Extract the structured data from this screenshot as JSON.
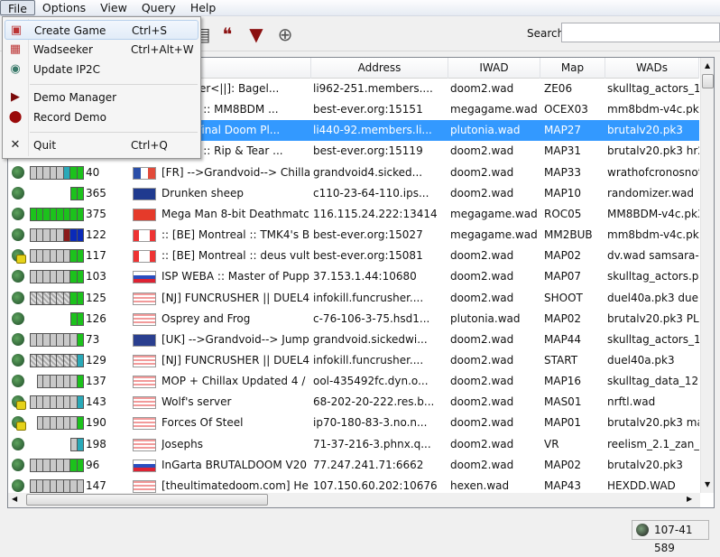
{
  "menubar": [
    "File",
    "Options",
    "View",
    "Query",
    "Help"
  ],
  "file_menu": [
    {
      "label": "Create Game",
      "shortcut": "Ctrl+S",
      "icon": "create-game-icon"
    },
    {
      "label": "Wadseeker",
      "shortcut": "Ctrl+Alt+W",
      "icon": "wadseeker-icon"
    },
    {
      "label": "Update IP2C",
      "shortcut": "",
      "icon": "globe-icon"
    },
    {
      "label": "Demo Manager",
      "shortcut": "",
      "icon": "play-icon"
    },
    {
      "label": "Record Demo",
      "shortcut": "",
      "icon": "record-icon"
    },
    {
      "label": "Quit",
      "shortcut": "Ctrl+Q",
      "icon": "close-icon"
    }
  ],
  "toolbar": {
    "icons": [
      "document-icon",
      "chat-icon",
      "filter-icon",
      "add-monitor-icon"
    ],
    "search_label": "Search:",
    "search_value": ""
  },
  "columns": [
    "rver Name",
    "Address",
    "IWAD",
    "Map",
    "WADs"
  ],
  "rows": [
    {
      "players": "",
      "ping": "",
      "flag": "",
      "name": "Painkiller<||]: Bagel...",
      "address": "li962-251.members....",
      "iwad": "doom2.wad",
      "map": "ZE06",
      "wads": "skulltag_actors_1-1",
      "lock": false
    },
    {
      "players": "",
      "ping": "",
      "flag": "",
      "name": "ontreal :: MM8BDM ...",
      "address": "best-ever.org:15151",
      "iwad": "megagame.wad",
      "map": "OCEX03",
      "wads": "mm8bdm-v4c.pk3",
      "lock": false
    },
    {
      "players": "",
      "ping": "",
      "flag": "",
      "name": "oom - Final Doom Pl...",
      "address": "li440-92.members.li...",
      "iwad": "plutonia.wad",
      "map": "MAP27",
      "wads": "brutalv20.pk3",
      "lock": false,
      "selected": true
    },
    {
      "players": "",
      "ping": "",
      "flag": "",
      "name": "ontreal :: Rip & Tear ...",
      "address": "best-ever.org:15119",
      "iwad": "doom2.wad",
      "map": "MAP31",
      "wads": "brutalv20.pk3 hr2fi",
      "lock": false
    },
    {
      "players": "gggggcGG",
      "ping": "40",
      "flag": "FR",
      "name": "[FR] -->Grandvoid--> Chilla...",
      "address": "grandvoid4.sicked...",
      "iwad": "doom2.wad",
      "map": "MAP33",
      "wads": "wrathofcronosnoth",
      "lock": false
    },
    {
      "players": "GG",
      "ping": "365",
      "flag": "AU",
      "name": "Drunken sheep",
      "address": "c110-23-64-110.ips...",
      "iwad": "doom2.wad",
      "map": "MAP10",
      "wads": "randomizer.wad",
      "lock": false
    },
    {
      "players": "GGGGGGGG",
      "ping": "375",
      "flag": "CN",
      "name": "Mega Man 8-bit Deathmatc...",
      "address": "116.115.24.222:13414",
      "iwad": "megagame.wad",
      "map": "ROC05",
      "wads": "MM8BDM-v4c.pk3",
      "lock": false
    },
    {
      "players": "gggggrBB",
      "ping": "122",
      "flag": "CA",
      "name": ":: [BE] Montreal :: TMK4's Bo...",
      "address": "best-ever.org:15027",
      "iwad": "megagame.wad",
      "map": "MM2BUB",
      "wads": "mm8bdm-v4c.pk3",
      "lock": false
    },
    {
      "players": "ggggggGG",
      "ping": "117",
      "flag": "CA",
      "name": ":: [BE] Montreal :: deus vult s...",
      "address": "best-ever.org:15081",
      "iwad": "doom2.wad",
      "map": "MAP02",
      "wads": "dv.wad samsara-v0",
      "lock": true
    },
    {
      "players": "ggggggGG",
      "ping": "103",
      "flag": "RU",
      "name": "ISP WEBA :: Master of Puppets",
      "address": "37.153.1.44:10680",
      "iwad": "doom2.wad",
      "map": "MAP07",
      "wads": "skulltag_actors.pk3",
      "lock": false
    },
    {
      "players": "xxxxxxGG",
      "ping": "125",
      "flag": "US",
      "name": "[NJ] FUNCRUSHER || DUEL40...",
      "address": "infokill.funcrusher....",
      "iwad": "doom2.wad",
      "map": "SHOOT",
      "wads": "duel40a.pk3 duelel",
      "lock": false
    },
    {
      "players": "GG",
      "ping": "126",
      "flag": "US",
      "name": "Osprey and Frog",
      "address": "c-76-106-3-75.hsd1...",
      "iwad": "plutonia.wad",
      "map": "MAP02",
      "wads": "brutalv20.pk3 PL2..",
      "lock": false
    },
    {
      "players": "gggggggG",
      "ping": "73",
      "flag": "UK",
      "name": "[UK] -->Grandvoid--> Jump ...",
      "address": "grandvoid.sickedwi...",
      "iwad": "doom2.wad",
      "map": "MAP44",
      "wads": "skulltag_actors_1-1",
      "lock": false
    },
    {
      "players": "xxxxxxxc",
      "ping": "129",
      "flag": "US",
      "name": "[NJ] FUNCRUSHER || DUEL40...",
      "address": "infokill.funcrusher....",
      "iwad": "doom2.wad",
      "map": "START",
      "wads": "duel40a.pk3",
      "lock": false
    },
    {
      "players": "ggggggG",
      "ping": "137",
      "flag": "US",
      "name": "MOP + Chillax Updated 4 / 9",
      "address": "ool-435492fc.dyn.o...",
      "iwad": "doom2.wad",
      "map": "MAP16",
      "wads": "skulltag_data_126.p",
      "lock": false
    },
    {
      "players": "gggggggc",
      "ping": "143",
      "flag": "US",
      "name": "Wolf's server",
      "address": "68-202-20-222.res.b...",
      "iwad": "doom2.wad",
      "map": "MAS01",
      "wads": "nrftl.wad",
      "lock": true
    },
    {
      "players": "ggggggG",
      "ping": "190",
      "flag": "US",
      "name": "Forces Of Steel",
      "address": "ip70-180-83-3.no.n...",
      "iwad": "doom2.wad",
      "map": "MAP01",
      "wads": "brutalv20.pk3 map",
      "lock": true
    },
    {
      "players": "gc",
      "ping": "198",
      "flag": "US",
      "name": "Josephs",
      "address": "71-37-216-3.phnx.q...",
      "iwad": "doom2.wad",
      "map": "VR",
      "wads": "reelism_2.1_zan_0.5",
      "lock": false
    },
    {
      "players": "ggggggGG",
      "ping": "96",
      "flag": "RU",
      "name": "InGarta BRUTALDOOM V20 E...",
      "address": "77.247.241.71:6662",
      "iwad": "doom2.wad",
      "map": "MAP02",
      "wads": "brutalv20.pk3",
      "lock": false
    },
    {
      "players": "gggggggg",
      "ping": "147",
      "flag": "US",
      "name": " [theultimatedoom.com] He...",
      "address": "107.150.60.202:10676",
      "iwad": "hexen.wad",
      "map": "MAP43",
      "wads": "HEXDD.WAD",
      "lock": false
    }
  ],
  "status": {
    "text": "107-41 589"
  },
  "colors": {
    "selection": "#3399ff",
    "player": "#1cc21c",
    "bot": "#c9c9c9",
    "spectator": "#29a9b8"
  }
}
